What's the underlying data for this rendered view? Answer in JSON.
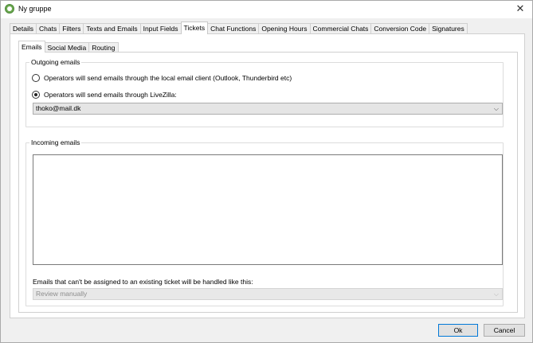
{
  "window": {
    "title": "Ny gruppe",
    "close_glyph": "✕"
  },
  "tabs": [
    {
      "label": "Details"
    },
    {
      "label": "Chats"
    },
    {
      "label": "Filters"
    },
    {
      "label": "Texts and Emails"
    },
    {
      "label": "Input Fields"
    },
    {
      "label": "Tickets",
      "active": true
    },
    {
      "label": "Chat Functions"
    },
    {
      "label": "Opening Hours"
    },
    {
      "label": "Commercial Chats"
    },
    {
      "label": "Conversion Code"
    },
    {
      "label": "Signatures"
    }
  ],
  "subtabs": [
    {
      "label": "Emails",
      "active": true
    },
    {
      "label": "Social Media"
    },
    {
      "label": "Routing"
    }
  ],
  "outgoing": {
    "legend": "Outgoing emails",
    "option_local": "Operators will send emails through the local email client (Outlook, Thunderbird etc)",
    "option_livezilla": "Operators will send emails through LiveZilla:",
    "selected": "livezilla",
    "account_value": "thoko@mail.dk"
  },
  "incoming": {
    "legend": "Incoming emails",
    "unassigned_label": "Emails that can't be assigned to an existing ticket will be handled like this:",
    "handling_value": "Review manually"
  },
  "footer": {
    "ok_label": "Ok",
    "cancel_label": "Cancel"
  },
  "icons": {
    "dropdown": "⌵"
  }
}
